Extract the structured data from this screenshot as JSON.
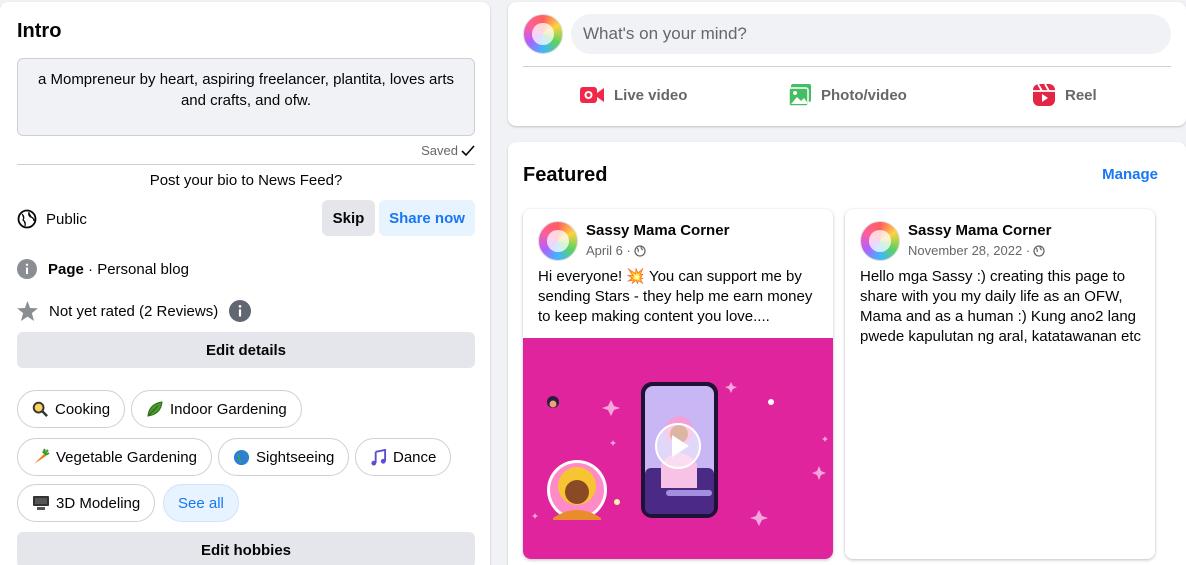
{
  "intro": {
    "title": "Intro",
    "bio": "a Mompreneur by heart, aspiring freelancer, plantita, loves arts and crafts, and ofw.",
    "saved_label": "Saved",
    "bio_prompt": "Post your bio to News Feed?",
    "privacy_label": "Public",
    "skip_label": "Skip",
    "share_label": "Share now",
    "page_label": "Page",
    "page_category": " · Personal blog",
    "rating_text": "Not yet rated (2 Reviews)",
    "edit_details_label": "Edit details",
    "hobbies": [
      {
        "label": "Cooking",
        "icon": "magnifier-icon"
      },
      {
        "label": "Indoor Gardening",
        "icon": "leaf-icon"
      },
      {
        "label": "Vegetable Gardening",
        "icon": "carrot-icon"
      },
      {
        "label": "Sightseeing",
        "icon": "globe-icon"
      },
      {
        "label": "Dance",
        "icon": "music-note-icon"
      },
      {
        "label": "3D Modeling",
        "icon": "computer-icon"
      }
    ],
    "see_all_label": "See all",
    "edit_hobbies_label": "Edit hobbies"
  },
  "composer": {
    "placeholder": "What's on your mind?",
    "actions": [
      {
        "label": "Live video",
        "icon": "live-video-icon",
        "color": "#f02849"
      },
      {
        "label": "Photo/video",
        "icon": "photo-icon",
        "color": "#45bd62"
      },
      {
        "label": "Reel",
        "icon": "reel-icon",
        "color": "#e42645"
      }
    ]
  },
  "featured": {
    "title": "Featured",
    "manage_label": "Manage",
    "posts": [
      {
        "author": "Sassy Mama Corner",
        "date": "April 6 ·",
        "text": "Hi everyone! 💥 You can support me by sending Stars - they help me earn money to keep making content you love...."
      },
      {
        "author": "Sassy Mama Corner",
        "date": "November 28, 2022 ·",
        "text": "Hello mga Sassy :) creating this page to share with you my daily life as an OFW, Mama and as a human :) Kung ano2 lang pwede kapulutan ng aral, katatawanan etc"
      }
    ]
  },
  "colors": {
    "accent": "#1877f2",
    "media_bg": "#e0249e"
  }
}
